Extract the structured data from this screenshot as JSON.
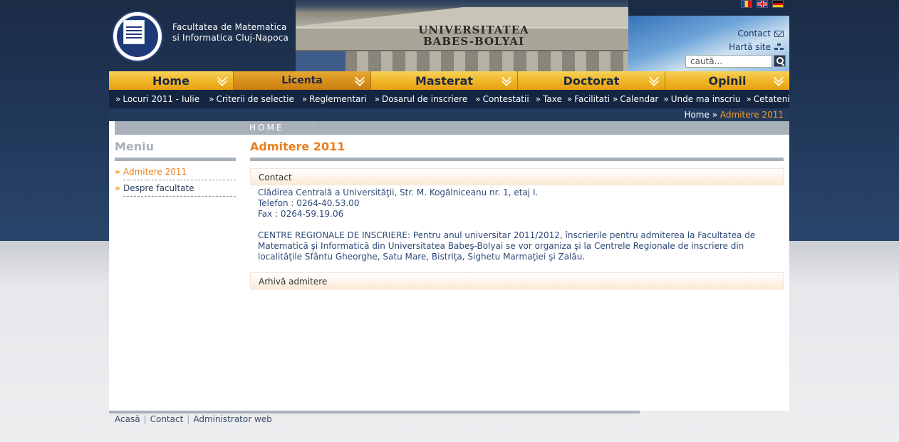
{
  "header": {
    "faculty_name_line1": "Facultatea de Matematica",
    "faculty_name_line2": "si Informatica Cluj-Napoca",
    "building_inscription_line1": "UNIVERSITATEA",
    "building_inscription_line2": "BABES-BOLYAI",
    "contact_link": "Contact",
    "sitemap_link": "Hartă site",
    "search_placeholder": "caută..."
  },
  "mainnav": [
    {
      "label": "Home"
    },
    {
      "label": "Licenta"
    },
    {
      "label": "Masterat"
    },
    {
      "label": "Doctorat"
    },
    {
      "label": "Opinii"
    }
  ],
  "subnav": [
    {
      "label": "Locuri 2011 - Iulie"
    },
    {
      "label": "Criterii de selectie"
    },
    {
      "label": "Reglementari"
    },
    {
      "label": "Dosarul de inscriere"
    },
    {
      "label": "Contestatii"
    },
    {
      "label": "Taxe"
    },
    {
      "label": "Facilitati"
    },
    {
      "label": "Calendar"
    },
    {
      "label": "Unde ma inscriu"
    },
    {
      "label": "Cetateni straini"
    }
  ],
  "breadcrumb": {
    "home": "Home",
    "separator": " » ",
    "current": "Admitere 2011"
  },
  "homebar": {
    "label": "HOME",
    "dot": "·"
  },
  "sidebar": {
    "title": "Meniu",
    "items": [
      {
        "label": "Admitere 2011"
      },
      {
        "label": "Despre facultate"
      }
    ]
  },
  "main": {
    "title": "Admitere 2011",
    "contact_heading": "Contact",
    "address": "Clădirea Centrală a Universităţii, Str. M. Kogălniceanu nr. 1, etaj I.",
    "phone": "Telefon : 0264-40.53.00",
    "fax": "Fax : 0264-59.19.06",
    "regional_text": "CENTRE REGIONALE DE INSCRIERE: Pentru anul universitar 2011/2012, înscrierile pentru admiterea la Facultatea de Matematică şi Informatică din Universitatea Babeş-Bolyai se vor organiza şi la Centrele Regionale de inscriere din localităţile Sfântu Gheorghe, Satu Mare, Bistriţa, Sighetu Marmaţiei şi Zalău.",
    "archive_heading": "Arhivă admitere"
  },
  "footer": {
    "links": [
      {
        "label": "Acasă"
      },
      {
        "label": "Contact"
      },
      {
        "label": "Administrator web"
      }
    ],
    "separator": "|"
  },
  "colors": {
    "nav_gold": "#f0b728",
    "accent_orange": "#ea7f1c",
    "navy": "#142541",
    "gray_bar": "#a8b1ba"
  }
}
